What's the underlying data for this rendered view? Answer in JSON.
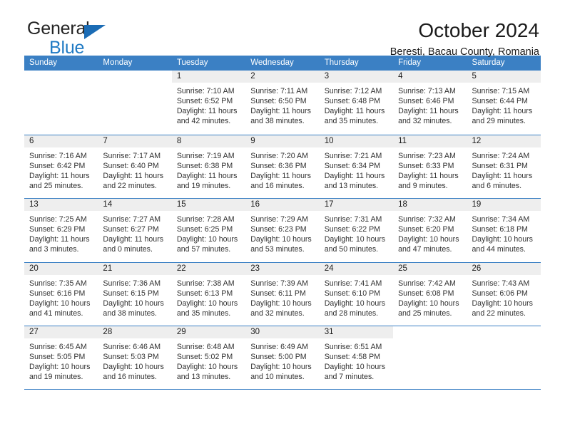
{
  "brand": {
    "name_part1": "General",
    "name_part2": "Blue",
    "triangle_color": "#1b6cb5",
    "blue_color": "#1f7ac4"
  },
  "header": {
    "title": "October 2024",
    "subtitle": "Beresti, Bacau County, Romania"
  },
  "theme": {
    "header_bar_color": "#3b80c4",
    "day_band_color": "#eeeeee",
    "rule_color": "#3b80c4"
  },
  "weekdays": [
    "Sunday",
    "Monday",
    "Tuesday",
    "Wednesday",
    "Thursday",
    "Friday",
    "Saturday"
  ],
  "weeks": [
    [
      {
        "day": "",
        "empty": true
      },
      {
        "day": "",
        "empty": true
      },
      {
        "day": "1",
        "sunrise": "Sunrise: 7:10 AM",
        "sunset": "Sunset: 6:52 PM",
        "daylight": "Daylight: 11 hours and 42 minutes."
      },
      {
        "day": "2",
        "sunrise": "Sunrise: 7:11 AM",
        "sunset": "Sunset: 6:50 PM",
        "daylight": "Daylight: 11 hours and 38 minutes."
      },
      {
        "day": "3",
        "sunrise": "Sunrise: 7:12 AM",
        "sunset": "Sunset: 6:48 PM",
        "daylight": "Daylight: 11 hours and 35 minutes."
      },
      {
        "day": "4",
        "sunrise": "Sunrise: 7:13 AM",
        "sunset": "Sunset: 6:46 PM",
        "daylight": "Daylight: 11 hours and 32 minutes."
      },
      {
        "day": "5",
        "sunrise": "Sunrise: 7:15 AM",
        "sunset": "Sunset: 6:44 PM",
        "daylight": "Daylight: 11 hours and 29 minutes."
      }
    ],
    [
      {
        "day": "6",
        "sunrise": "Sunrise: 7:16 AM",
        "sunset": "Sunset: 6:42 PM",
        "daylight": "Daylight: 11 hours and 25 minutes."
      },
      {
        "day": "7",
        "sunrise": "Sunrise: 7:17 AM",
        "sunset": "Sunset: 6:40 PM",
        "daylight": "Daylight: 11 hours and 22 minutes."
      },
      {
        "day": "8",
        "sunrise": "Sunrise: 7:19 AM",
        "sunset": "Sunset: 6:38 PM",
        "daylight": "Daylight: 11 hours and 19 minutes."
      },
      {
        "day": "9",
        "sunrise": "Sunrise: 7:20 AM",
        "sunset": "Sunset: 6:36 PM",
        "daylight": "Daylight: 11 hours and 16 minutes."
      },
      {
        "day": "10",
        "sunrise": "Sunrise: 7:21 AM",
        "sunset": "Sunset: 6:34 PM",
        "daylight": "Daylight: 11 hours and 13 minutes."
      },
      {
        "day": "11",
        "sunrise": "Sunrise: 7:23 AM",
        "sunset": "Sunset: 6:33 PM",
        "daylight": "Daylight: 11 hours and 9 minutes."
      },
      {
        "day": "12",
        "sunrise": "Sunrise: 7:24 AM",
        "sunset": "Sunset: 6:31 PM",
        "daylight": "Daylight: 11 hours and 6 minutes."
      }
    ],
    [
      {
        "day": "13",
        "sunrise": "Sunrise: 7:25 AM",
        "sunset": "Sunset: 6:29 PM",
        "daylight": "Daylight: 11 hours and 3 minutes."
      },
      {
        "day": "14",
        "sunrise": "Sunrise: 7:27 AM",
        "sunset": "Sunset: 6:27 PM",
        "daylight": "Daylight: 11 hours and 0 minutes."
      },
      {
        "day": "15",
        "sunrise": "Sunrise: 7:28 AM",
        "sunset": "Sunset: 6:25 PM",
        "daylight": "Daylight: 10 hours and 57 minutes."
      },
      {
        "day": "16",
        "sunrise": "Sunrise: 7:29 AM",
        "sunset": "Sunset: 6:23 PM",
        "daylight": "Daylight: 10 hours and 53 minutes."
      },
      {
        "day": "17",
        "sunrise": "Sunrise: 7:31 AM",
        "sunset": "Sunset: 6:22 PM",
        "daylight": "Daylight: 10 hours and 50 minutes."
      },
      {
        "day": "18",
        "sunrise": "Sunrise: 7:32 AM",
        "sunset": "Sunset: 6:20 PM",
        "daylight": "Daylight: 10 hours and 47 minutes."
      },
      {
        "day": "19",
        "sunrise": "Sunrise: 7:34 AM",
        "sunset": "Sunset: 6:18 PM",
        "daylight": "Daylight: 10 hours and 44 minutes."
      }
    ],
    [
      {
        "day": "20",
        "sunrise": "Sunrise: 7:35 AM",
        "sunset": "Sunset: 6:16 PM",
        "daylight": "Daylight: 10 hours and 41 minutes."
      },
      {
        "day": "21",
        "sunrise": "Sunrise: 7:36 AM",
        "sunset": "Sunset: 6:15 PM",
        "daylight": "Daylight: 10 hours and 38 minutes."
      },
      {
        "day": "22",
        "sunrise": "Sunrise: 7:38 AM",
        "sunset": "Sunset: 6:13 PM",
        "daylight": "Daylight: 10 hours and 35 minutes."
      },
      {
        "day": "23",
        "sunrise": "Sunrise: 7:39 AM",
        "sunset": "Sunset: 6:11 PM",
        "daylight": "Daylight: 10 hours and 32 minutes."
      },
      {
        "day": "24",
        "sunrise": "Sunrise: 7:41 AM",
        "sunset": "Sunset: 6:10 PM",
        "daylight": "Daylight: 10 hours and 28 minutes."
      },
      {
        "day": "25",
        "sunrise": "Sunrise: 7:42 AM",
        "sunset": "Sunset: 6:08 PM",
        "daylight": "Daylight: 10 hours and 25 minutes."
      },
      {
        "day": "26",
        "sunrise": "Sunrise: 7:43 AM",
        "sunset": "Sunset: 6:06 PM",
        "daylight": "Daylight: 10 hours and 22 minutes."
      }
    ],
    [
      {
        "day": "27",
        "sunrise": "Sunrise: 6:45 AM",
        "sunset": "Sunset: 5:05 PM",
        "daylight": "Daylight: 10 hours and 19 minutes."
      },
      {
        "day": "28",
        "sunrise": "Sunrise: 6:46 AM",
        "sunset": "Sunset: 5:03 PM",
        "daylight": "Daylight: 10 hours and 16 minutes."
      },
      {
        "day": "29",
        "sunrise": "Sunrise: 6:48 AM",
        "sunset": "Sunset: 5:02 PM",
        "daylight": "Daylight: 10 hours and 13 minutes."
      },
      {
        "day": "30",
        "sunrise": "Sunrise: 6:49 AM",
        "sunset": "Sunset: 5:00 PM",
        "daylight": "Daylight: 10 hours and 10 minutes."
      },
      {
        "day": "31",
        "sunrise": "Sunrise: 6:51 AM",
        "sunset": "Sunset: 4:58 PM",
        "daylight": "Daylight: 10 hours and 7 minutes."
      },
      {
        "day": "",
        "empty": true
      },
      {
        "day": "",
        "empty": true
      }
    ]
  ]
}
